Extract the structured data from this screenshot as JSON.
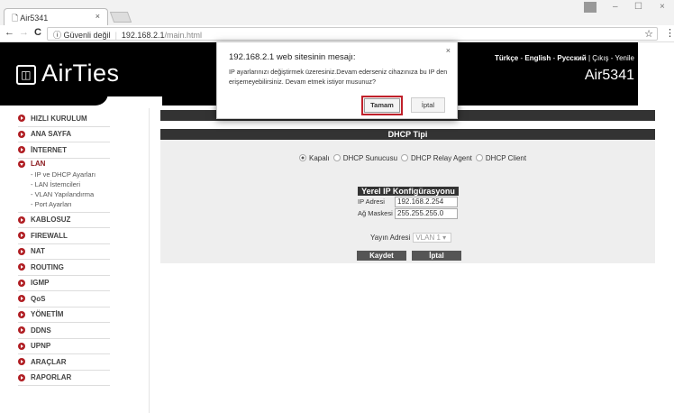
{
  "browser": {
    "tab_title": "Air5341",
    "tab_close": "×",
    "security": "Güvenli değil",
    "url_host": "192.168.2.1",
    "url_path": "/main.html",
    "minimize": "–",
    "maximize": "☐",
    "close": "×",
    "star": "☆",
    "menu": "⋮",
    "back": "←",
    "forward": "→",
    "reload": "C",
    "info": "ⓘ"
  },
  "header": {
    "logo": "AirTies",
    "logo_icon": "◫",
    "lang_tr": "Türkçe",
    "lang_en": "English",
    "lang_ru": "Русский",
    "sep": "-",
    "bar": "|",
    "logout": "Çıkış",
    "refresh": "Yenile",
    "model": "Air5341"
  },
  "sidebar": {
    "items": [
      {
        "label": "HIZLI KURULUM"
      },
      {
        "label": "ANA SAYFA"
      },
      {
        "label": "İNTERNET"
      },
      {
        "label": "LAN",
        "sub": [
          "- IP ve DHCP Ayarları",
          "- LAN İstemcileri",
          "- VLAN Yapılandırma",
          "- Port Ayarları"
        ]
      },
      {
        "label": "KABLOSUZ"
      },
      {
        "label": "FIREWALL"
      },
      {
        "label": "NAT"
      },
      {
        "label": "ROUTING"
      },
      {
        "label": "IGMP"
      },
      {
        "label": "QoS"
      },
      {
        "label": "YÖNETİM"
      },
      {
        "label": "DDNS"
      },
      {
        "label": "UPNP"
      },
      {
        "label": "ARAÇLAR"
      },
      {
        "label": "RAPORLAR"
      }
    ]
  },
  "main": {
    "section_title": "DHCP Tipi",
    "dhcp_options": [
      "Kapalı",
      "DHCP Sunucusu",
      "DHCP Relay Agent",
      "DHCP Client"
    ],
    "selected_option": "Kapalı",
    "ip_config_title": "Yerel IP Konfigürasyonu",
    "ip_label": "IP Adresi",
    "ip_value": "192.168.2.254",
    "mask_label": "Ağ Maskesi",
    "mask_value": "255.255.255.0",
    "broadcast_label": "Yayın Adresi",
    "broadcast_value": "VLAN 1 ▾",
    "save": "Kaydet",
    "cancel": "İptal"
  },
  "dialog": {
    "title": "192.168.2.1 web sitesinin mesajı:",
    "message": "IP ayarlarınızı değiştirmek üzeresiniz.Devam ederseniz cihazınıza bu IP den erişemeyebilirsiniz. Devam etmek istiyor musunuz?",
    "ok": "Tamam",
    "cancel": "İptal",
    "close": "×"
  },
  "colors": {
    "accent": "#b01e23",
    "bar": "#333333"
  }
}
